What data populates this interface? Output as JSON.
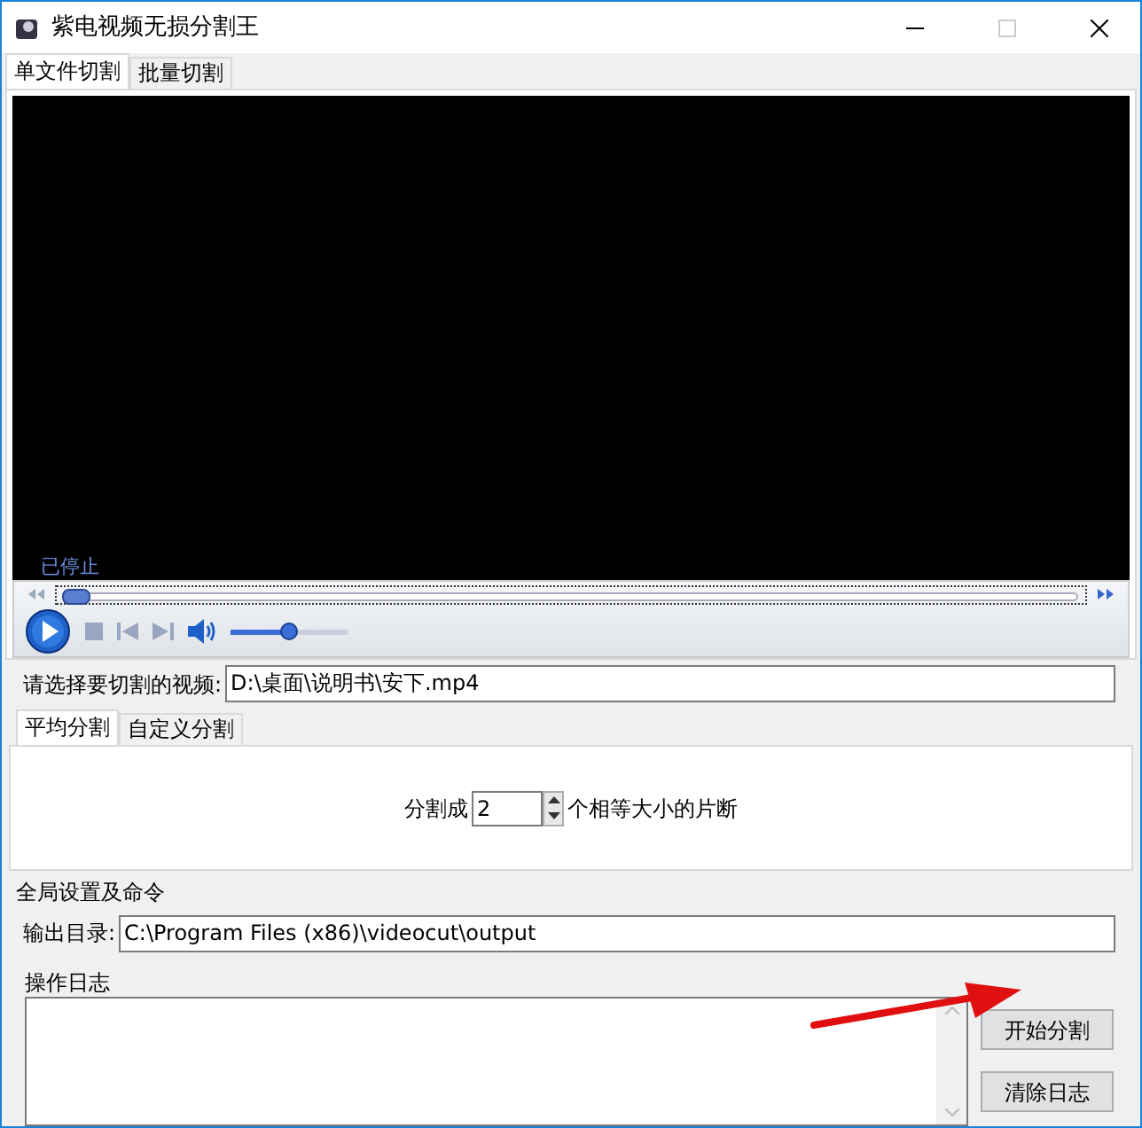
{
  "window": {
    "title": "紫电视频无损分割王"
  },
  "tabs": [
    {
      "label": "单文件切割",
      "selected": true
    },
    {
      "label": "批量切割",
      "selected": false
    }
  ],
  "player": {
    "status": "已停止",
    "seek": {
      "level": 0.0
    },
    "volume": {
      "level": 0.5
    }
  },
  "video_field": {
    "label": "请选择要切割的视频:",
    "value": "D:\\桌面\\说明书\\安下.mp4"
  },
  "split_tabs": [
    {
      "label": "平均分割",
      "selected": true
    },
    {
      "label": "自定义分割",
      "selected": false
    }
  ],
  "split": {
    "prefix": "分割成",
    "value": "2",
    "suffix": "个相等大小的片断"
  },
  "global": {
    "title": "全局设置及命令",
    "output_label": "输出目录:",
    "output_value": "C:\\Program Files (x86)\\videocut\\output",
    "log_label": "操作日志"
  },
  "buttons": [
    {
      "label": "开始分割"
    },
    {
      "label": "清除日志"
    }
  ]
}
